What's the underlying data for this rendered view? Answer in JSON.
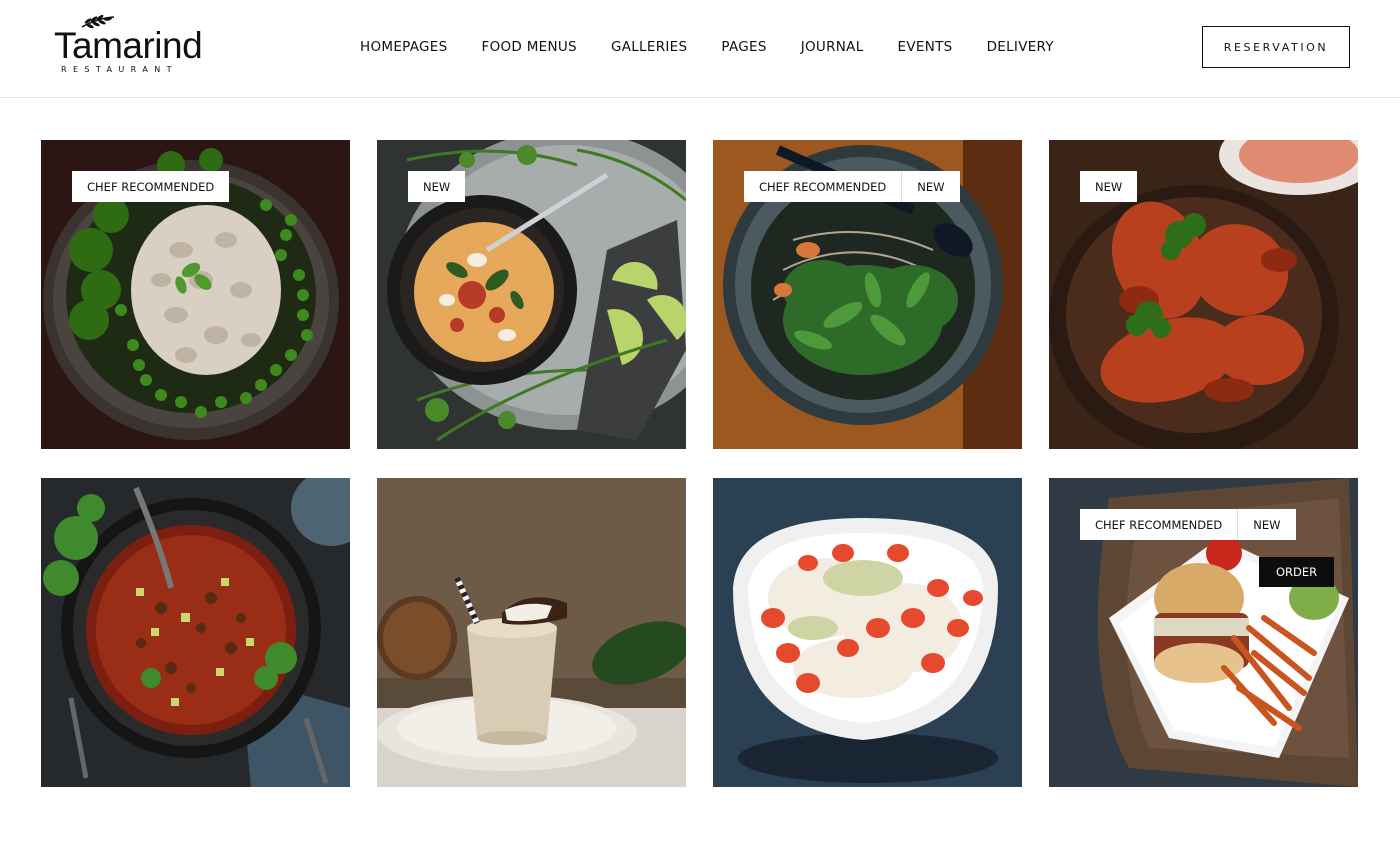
{
  "brand": {
    "name": "Tamarind",
    "tagline": "RESTAURANT"
  },
  "nav": {
    "items": [
      {
        "label": "HOMEPAGES",
        "key": "homepages"
      },
      {
        "label": "FOOD MENUS",
        "key": "food-menus"
      },
      {
        "label": "GALLERIES",
        "key": "galleries"
      },
      {
        "label": "PAGES",
        "key": "pages"
      },
      {
        "label": "JOURNAL",
        "key": "journal"
      },
      {
        "label": "EVENTS",
        "key": "events"
      },
      {
        "label": "DELIVERY",
        "key": "delivery"
      }
    ],
    "reservation_label": "RESERVATION"
  },
  "dishes": [
    {
      "badges": [
        "CHEF RECOMMENDED"
      ],
      "icon": "pasta-peas-broccoli-dish-image"
    },
    {
      "badges": [
        "NEW"
      ],
      "icon": "curry-bowl-dish-image"
    },
    {
      "badges": [
        "CHEF RECOMMENDED",
        "NEW"
      ],
      "icon": "noodle-greens-bowl-dish-image"
    },
    {
      "badges": [
        "NEW"
      ],
      "icon": "glazed-chicken-wings-dish-image"
    },
    {
      "badges": [],
      "icon": "chili-skillet-dish-image"
    },
    {
      "badges": [],
      "icon": "coconut-smoothie-dish-image"
    },
    {
      "badges": [],
      "icon": "strawberry-dessert-bowl-dish-image"
    },
    {
      "badges": [
        "CHEF RECOMMENDED",
        "NEW"
      ],
      "order_label": "ORDER",
      "icon": "burger-fries-plate-dish-image"
    }
  ],
  "colors": {
    "text": "#111111",
    "header_border": "#e6e6e6",
    "order_button": "#0d0d0d"
  }
}
